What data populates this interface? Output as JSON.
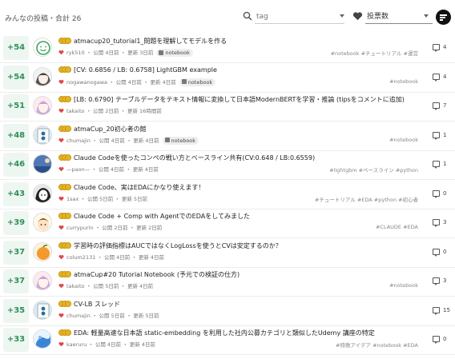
{
  "header": {
    "title": "みんなの投稿・合計 26",
    "search_placeholder": "tag",
    "sort_value": "投票数"
  },
  "items": [
    {
      "score": "+54",
      "title": "atmacup20_tutorial1_問題を理解してモデルを作る",
      "author": "ryk510",
      "published": "公開 4日前",
      "updated": "更新 3日前",
      "badge": "notebook",
      "tags": "#notebook #チュートリアル #運営",
      "comments": "4",
      "avatar": "face"
    },
    {
      "score": "+54",
      "title": "[CV: 0.6856 / LB: 0.6758] LightGBM example",
      "author": "nogawanogawa",
      "published": "公開 4日前",
      "updated": "更新 4日前",
      "badge": "notebook",
      "tags": "#notebook",
      "comments": "4",
      "avatar": "anime-bw"
    },
    {
      "score": "+51",
      "title": "[LB: 0.6790] テーブルデータをテキスト情報に変換して日本語ModernBERTを学習・推論 (tipsをコメントに追加)",
      "author": "takaito",
      "published": "公開 2日前",
      "updated": "更新 16時間前",
      "badge": "",
      "tags": "",
      "comments": "7",
      "avatar": "anime-pink"
    },
    {
      "score": "+48",
      "title": "atmaCup_20初心者の館",
      "author": "chumajin",
      "published": "公開 4日前",
      "updated": "更新 4日前",
      "badge": "notebook",
      "tags": "#notebook",
      "comments": "1",
      "avatar": "tile"
    },
    {
      "score": "+46",
      "title": "Claude Codeを使ったコンペの戦い方とベースライン共有(CV:0.648 / LB:0.6559)",
      "author": "—paon—",
      "published": "公開 4日前",
      "updated": "更新 4日前",
      "badge": "",
      "tags": "#lightgbm #ベースライン #python",
      "comments": "1",
      "avatar": "sky"
    },
    {
      "score": "+43",
      "title": "Claude Code、実はEDAにかなり使えます！",
      "author": "1sax",
      "published": "公開 5日前",
      "updated": "更新 5日前",
      "badge": "",
      "tags": "#チュートリアル #EDA #python #初心者",
      "comments": "0",
      "avatar": "anime-dark"
    },
    {
      "score": "+39",
      "title": "Claude Code + Comp with AgentでのEDAをしてみました",
      "author": "currypurin",
      "published": "公開 2日前",
      "updated": "更新 2日前",
      "badge": "",
      "tags": "#CLAUDE #EDA",
      "comments": "3",
      "avatar": "boy"
    },
    {
      "score": "+37",
      "title": "学習時の評価指標はAUCではなくLogLossを使うとCVは安定するのか？",
      "author": "colum2131",
      "published": "公開 4日前",
      "updated": "更新 4日前",
      "badge": "",
      "tags": "",
      "comments": "0",
      "avatar": "orange"
    },
    {
      "score": "+37",
      "title": "atmaCup#20 Tutorial Notebook (予元での検証の仕方)",
      "author": "takaito",
      "published": "公開 5日前",
      "updated": "更新 4日前",
      "badge": "",
      "tags": "#notebook",
      "comments": "3",
      "avatar": "anime-pink"
    },
    {
      "score": "+35",
      "title": "CV-LB スレッド",
      "author": "chumajin",
      "published": "公開 5日前",
      "updated": "更新 5日前",
      "badge": "",
      "tags": "",
      "comments": "15",
      "avatar": "tile"
    },
    {
      "score": "+33",
      "title": "EDA: 軽量高速な日本語 static-embedding を利用した社内公募カテゴリと類似したUdemy 講座の特定",
      "author": "kaeruru",
      "published": "公開 4日前",
      "updated": "更新 4日前",
      "badge": "",
      "tags": "#特徴アイデア #notebook #EDA",
      "comments": "0",
      "avatar": "blue"
    }
  ],
  "colors": {
    "score_green": "#2e8f5b",
    "score_bg": "#eef6f1",
    "heart_red": "#e0484b",
    "coin_gold": "#e6b422"
  },
  "icons": [
    "search-icon",
    "heart-icon",
    "sort-icon",
    "comment-icon",
    "notebook-icon",
    "coin-tier-icon",
    "chevron-down-icon"
  ]
}
